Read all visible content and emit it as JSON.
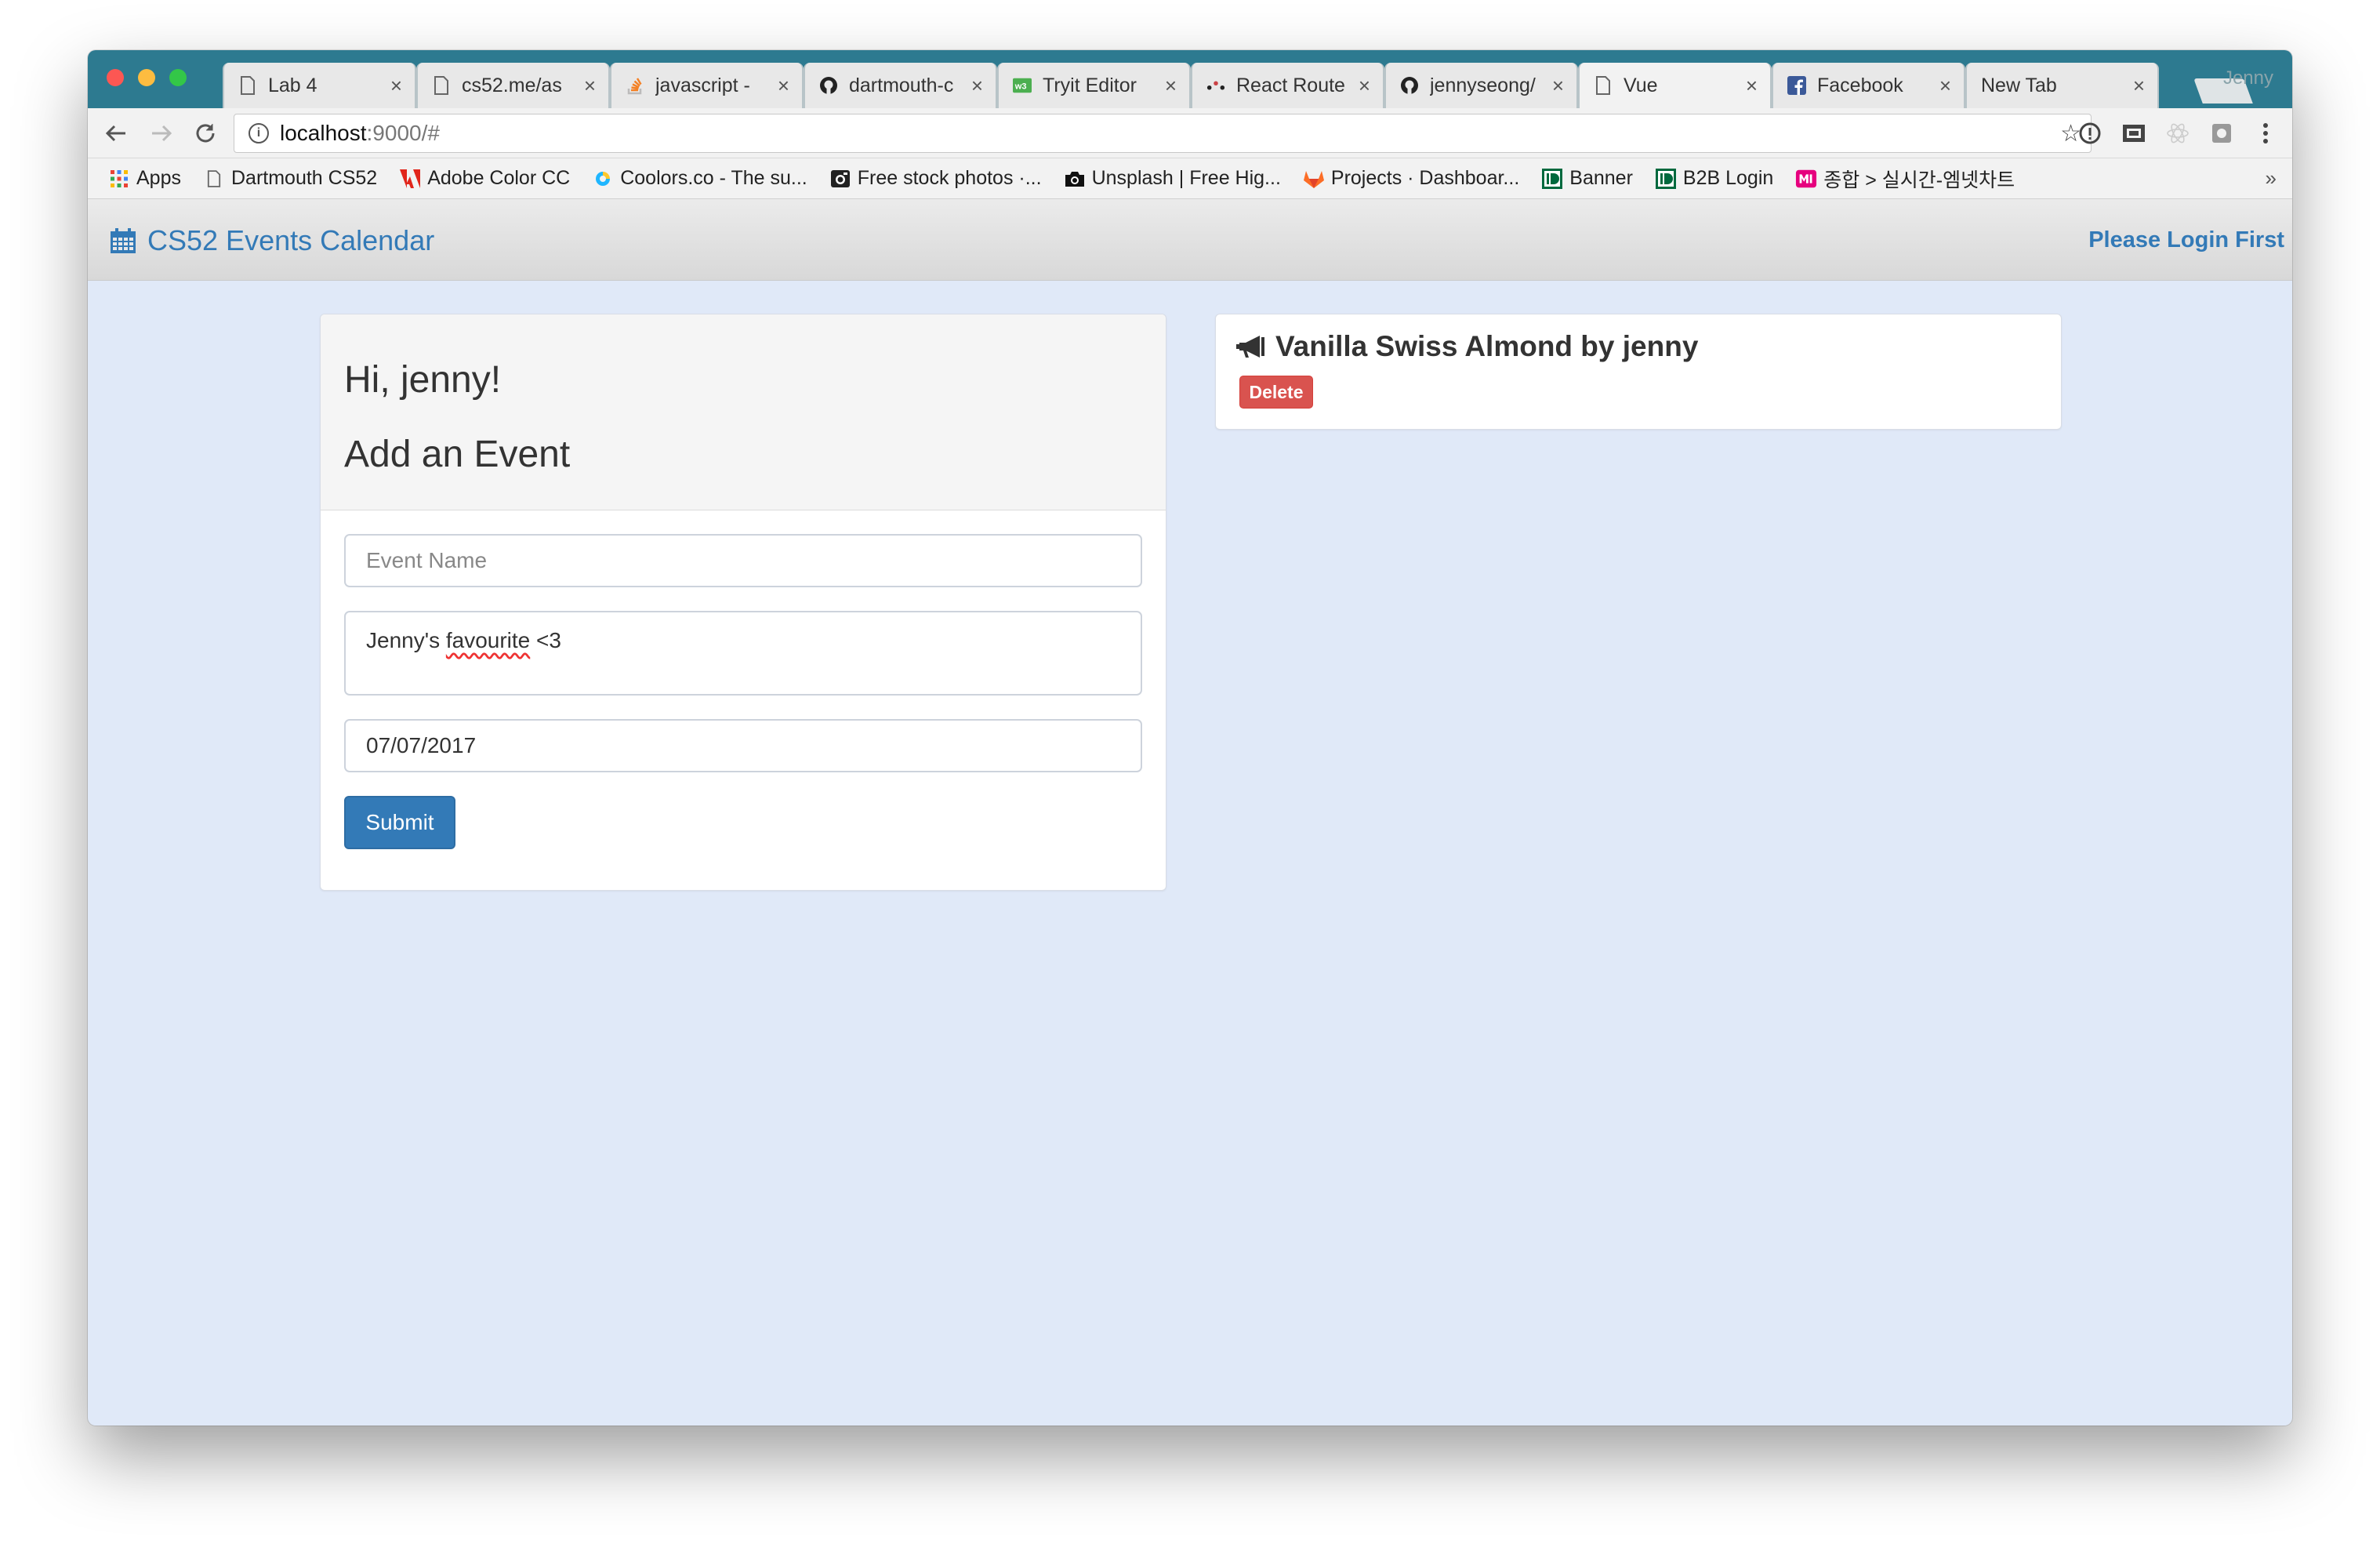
{
  "browser": {
    "tabs": [
      {
        "label": "Lab 4",
        "icon": "page-icon"
      },
      {
        "label": "cs52.me/as",
        "icon": "page-icon"
      },
      {
        "label": "javascript - ",
        "icon": "stackoverflow-icon"
      },
      {
        "label": "dartmouth-c",
        "icon": "github-icon"
      },
      {
        "label": "Tryit Editor",
        "icon": "w3schools-icon"
      },
      {
        "label": "React Route",
        "icon": "react-router-icon"
      },
      {
        "label": "jennyseong/",
        "icon": "github-icon"
      },
      {
        "label": "Vue",
        "icon": "page-icon",
        "active": true
      },
      {
        "label": "Facebook",
        "icon": "facebook-icon"
      },
      {
        "label": "New Tab",
        "icon": ""
      }
    ],
    "profile_name": "Jenny",
    "url_host": "localhost",
    "url_path": ":9000/#",
    "bookmarks": [
      {
        "label": "Apps",
        "icon": "apps-grid-icon"
      },
      {
        "label": "Dartmouth CS52",
        "icon": "page-icon"
      },
      {
        "label": "Adobe Color CC",
        "icon": "adobe-icon"
      },
      {
        "label": "Coolors.co - The su...",
        "icon": "coolors-icon"
      },
      {
        "label": "Free stock photos ·...",
        "icon": "camera-icon"
      },
      {
        "label": "Unsplash | Free Hig...",
        "icon": "camera-icon"
      },
      {
        "label": "Projects · Dashboar...",
        "icon": "gitlab-icon"
      },
      {
        "label": "Banner",
        "icon": "dartmouth-icon"
      },
      {
        "label": "B2B Login",
        "icon": "dartmouth-icon"
      },
      {
        "label": "종합 > 실시간-엠넷차트",
        "icon": "mnet-icon"
      }
    ],
    "bookmarks_more": "»"
  },
  "app": {
    "brand": "CS52 Events Calendar",
    "login_link": "Please Login First",
    "form": {
      "greeting": "Hi, jenny!",
      "title": "Add an Event",
      "name_placeholder": "Event Name",
      "description_prefix": "Jenny's ",
      "description_misspelled": "favourite",
      "description_suffix": " <3",
      "date_value": "07/07/2017",
      "submit_label": "Submit"
    },
    "event": {
      "title": "Vanilla Swiss Almond by jenny",
      "delete_label": "Delete"
    }
  },
  "colors": {
    "tabstrip": "#2d7a90",
    "page_background": "#e0e9f8",
    "brand_blue": "#337ab7",
    "delete_red": "#d9534f"
  }
}
